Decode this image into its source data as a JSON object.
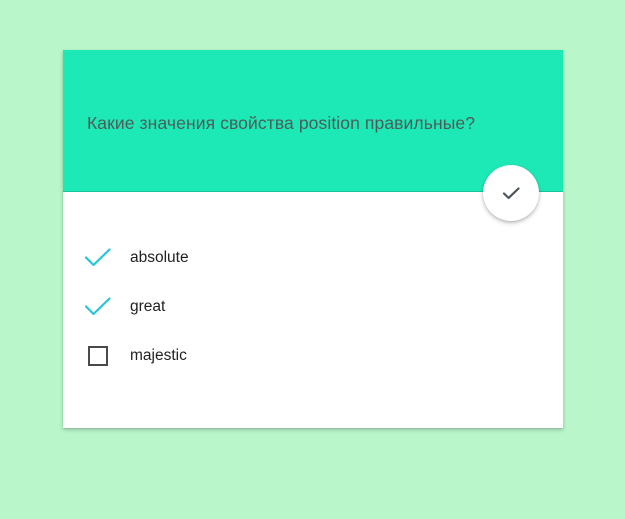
{
  "quiz": {
    "question": "Какие значения свойства position правильные?",
    "submit_icon": "check-icon",
    "options": [
      {
        "label": "absolute",
        "checked": true
      },
      {
        "label": "great",
        "checked": true
      },
      {
        "label": "majestic",
        "checked": false
      }
    ]
  },
  "colors": {
    "page_background": "#b9f6ca",
    "header_background": "#1de9b6",
    "check_accent": "#26c6da",
    "question_text": "#4e5b59"
  }
}
